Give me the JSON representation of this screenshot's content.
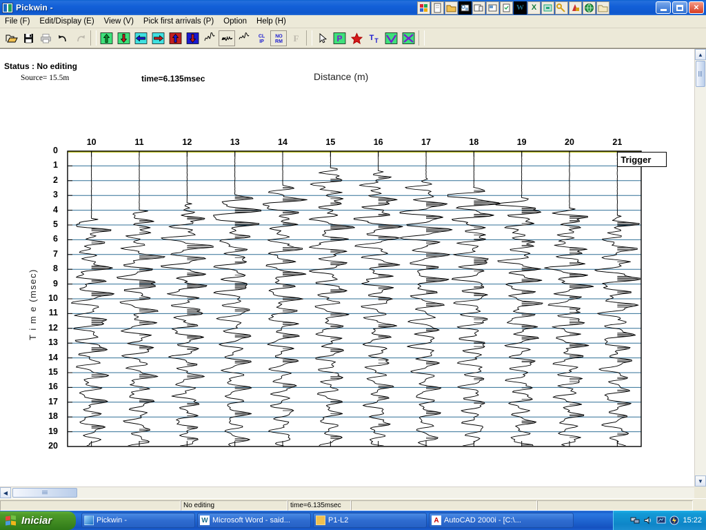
{
  "window": {
    "title": "Pickwin -",
    "icon": "pickwin-icon",
    "controls": {
      "minimize": "_",
      "maximize": "□",
      "close": "✕"
    }
  },
  "office_bar": {
    "items": [
      {
        "name": "office-logo-icon",
        "glyph": ""
      },
      {
        "name": "new-document-icon",
        "glyph": ""
      },
      {
        "name": "open-folder-icon",
        "glyph": ""
      },
      {
        "name": "new-appointment-icon",
        "glyph": ""
      },
      {
        "name": "new-message-icon",
        "glyph": ""
      },
      {
        "name": "new-contact-icon",
        "glyph": ""
      },
      {
        "name": "new-task-icon",
        "glyph": ""
      },
      {
        "name": "microsoft-word-icon",
        "glyph": "W"
      },
      {
        "name": "microsoft-excel-icon",
        "glyph": "X"
      },
      {
        "name": "powerpoint-icon",
        "glyph": ""
      },
      {
        "name": "key-icon",
        "glyph": ""
      },
      {
        "name": "access-icon",
        "glyph": ""
      },
      {
        "name": "internet-globe-icon",
        "glyph": ""
      },
      {
        "name": "my-documents-icon",
        "glyph": ""
      }
    ]
  },
  "menu": {
    "items": [
      {
        "label": "File (F)",
        "name": "menu-file"
      },
      {
        "label": "Edit/Display (E)",
        "name": "menu-edit-display"
      },
      {
        "label": "View (V)",
        "name": "menu-view"
      },
      {
        "label": "Pick first arrivals (P)",
        "name": "menu-pick-first-arrivals"
      },
      {
        "label": "Option",
        "name": "menu-option"
      },
      {
        "label": "Help (H)",
        "name": "menu-help"
      }
    ]
  },
  "toolbar": {
    "buttons": [
      {
        "name": "open-file-button",
        "icon": "open-folder-icon",
        "tip": "Open"
      },
      {
        "name": "save-button",
        "icon": "floppy-disk-icon",
        "tip": "Save"
      },
      {
        "name": "print-button",
        "icon": "printer-icon",
        "tip": "Print"
      },
      {
        "name": "undo-button",
        "icon": "undo-arrow-icon",
        "tip": "Undo"
      },
      {
        "name": "redo-button",
        "icon": "redo-arrow-icon",
        "tip": "Redo"
      },
      {
        "name": "scroll-up-button",
        "icon": "up-arrow-green-icon",
        "tip": "Up"
      },
      {
        "name": "scroll-down-button",
        "icon": "down-arrow-green-icon",
        "tip": "Down"
      },
      {
        "name": "scroll-left-button",
        "icon": "left-arrow-cyan-icon",
        "tip": "Left"
      },
      {
        "name": "scroll-right-button",
        "icon": "right-arrow-cyan-icon",
        "tip": "Right"
      },
      {
        "name": "expand-vertical-button",
        "icon": "expand-up-blue-icon",
        "tip": "Expand"
      },
      {
        "name": "shrink-vertical-button",
        "icon": "shrink-down-blue-icon",
        "tip": "Shrink"
      },
      {
        "name": "wiggle-trace-button",
        "icon": "wave-icon",
        "tip": "Wiggle"
      },
      {
        "name": "variable-area-button",
        "icon": "wave-filled-icon",
        "tip": "Variable area"
      },
      {
        "name": "wave-plain-button",
        "icon": "wave-small-icon",
        "tip": "Wave"
      },
      {
        "name": "clip-button",
        "icon": "clip-text-icon",
        "label": "CL IP"
      },
      {
        "name": "normalize-button",
        "icon": "norm-text-icon",
        "label": "NO RM"
      },
      {
        "name": "filter-button",
        "icon": "f-text-icon",
        "label": "F"
      },
      {
        "name": "select-pointer-button",
        "icon": "cursor-arrow-icon",
        "tip": "Select"
      },
      {
        "name": "pick-button",
        "icon": "p-green-icon",
        "label": "P"
      },
      {
        "name": "delete-pick-button",
        "icon": "red-star-icon",
        "tip": "Delete pick"
      },
      {
        "name": "text-tool-button",
        "icon": "tt-text-icon",
        "label": "T"
      },
      {
        "name": "accept-button",
        "icon": "green-check-icon",
        "tip": "Accept"
      },
      {
        "name": "cancel-button",
        "icon": "purple-cross-icon",
        "tip": "Cancel"
      }
    ]
  },
  "plot_header": {
    "status": "Status : No editing",
    "source": "Source= 15.5m",
    "time": "time=6.135msec",
    "distance_label": "Distance (m)",
    "trigger_label": "Trigger"
  },
  "chart_data": {
    "type": "line",
    "title": "",
    "subtitle": "",
    "xlabel": "Distance (m)",
    "ylabel": "T i m e (msec)",
    "xlim": [
      9.5,
      21.5
    ],
    "ylim": [
      0,
      20
    ],
    "y_inverted": true,
    "grid": true,
    "legend": "none",
    "x_ticks": [
      10,
      11,
      12,
      13,
      14,
      15,
      16,
      17,
      18,
      19,
      20,
      21
    ],
    "y_ticks": [
      0,
      1,
      2,
      3,
      4,
      5,
      6,
      7,
      8,
      9,
      10,
      11,
      12,
      13,
      14,
      15,
      16,
      17,
      18,
      19,
      20
    ],
    "trigger_time": 0,
    "source_position": 15.5,
    "cursor_time": 6.135,
    "trace_colors": {
      "trace": "#000000",
      "grid": "#2f6f96",
      "trigger_line": "#b9bd17",
      "axis": "#000000",
      "background": "#ffffff"
    },
    "series": [
      {
        "name": "trace-10",
        "x": 10,
        "first_break": 4.6,
        "amplitude": 1.0
      },
      {
        "name": "trace-11",
        "x": 11,
        "first_break": 4.1,
        "amplitude": 1.0
      },
      {
        "name": "trace-12",
        "x": 12,
        "first_break": 3.6,
        "amplitude": 1.0
      },
      {
        "name": "trace-13",
        "x": 13,
        "first_break": 3.0,
        "amplitude": 1.0
      },
      {
        "name": "trace-14",
        "x": 14,
        "first_break": 2.4,
        "amplitude": 1.0
      },
      {
        "name": "trace-15",
        "x": 15,
        "first_break": 1.2,
        "amplitude": 1.0
      },
      {
        "name": "trace-16",
        "x": 16,
        "first_break": 1.4,
        "amplitude": 1.0
      },
      {
        "name": "trace-17",
        "x": 17,
        "first_break": 1.9,
        "amplitude": 1.0
      },
      {
        "name": "trace-18",
        "x": 18,
        "first_break": 2.5,
        "amplitude": 1.0
      },
      {
        "name": "trace-19",
        "x": 19,
        "first_break": 3.2,
        "amplitude": 1.0
      },
      {
        "name": "trace-20",
        "x": 20,
        "first_break": 3.9,
        "amplitude": 1.0
      },
      {
        "name": "trace-21",
        "x": 21,
        "first_break": 4.4,
        "amplitude": 1.0
      }
    ]
  },
  "statusbar": {
    "cells": [
      "",
      "No editing",
      "time=6.135msec",
      "",
      ""
    ]
  },
  "taskbar": {
    "start_label": "Iniciar",
    "tasks": [
      {
        "label": "Pickwin -",
        "name": "taskbar-item-pickwin",
        "icon": "pickwin-icon"
      },
      {
        "label": "Microsoft Word - said...",
        "name": "taskbar-item-word",
        "icon": "word-icon"
      },
      {
        "label": "P1-L2",
        "name": "taskbar-item-p1l2",
        "icon": "folder-icon"
      },
      {
        "label": "AutoCAD 2000i - [C:\\...",
        "name": "taskbar-item-autocad",
        "icon": "autocad-icon"
      }
    ],
    "tray_icons": [
      "network-icon",
      "volume-icon",
      "display-icon",
      "power-icon"
    ],
    "clock": "15:22"
  }
}
